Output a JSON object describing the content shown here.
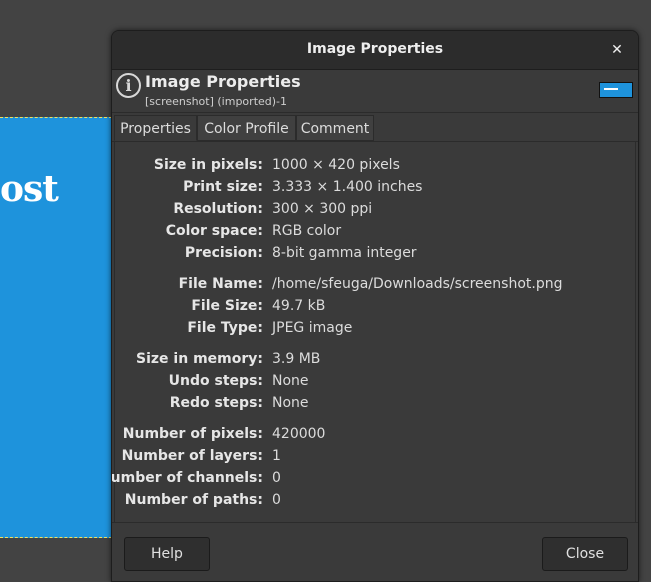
{
  "canvas": {
    "text": "ost"
  },
  "dialog": {
    "title": "Image Properties",
    "close_glyph": "✕",
    "header": {
      "icon": "info-icon",
      "title": "Image Properties",
      "subtitle": "[screenshot] (imported)-1"
    },
    "tabs": [
      {
        "label": "Properties",
        "active": true
      },
      {
        "label": "Color Profile",
        "active": false
      },
      {
        "label": "Comment",
        "active": false
      }
    ],
    "properties": [
      {
        "label": "Size in pixels:",
        "value": "1000 × 420 pixels"
      },
      {
        "label": "Print size:",
        "value": "3.333 × 1.400 inches"
      },
      {
        "label": "Resolution:",
        "value": "300 × 300 ppi"
      },
      {
        "label": "Color space:",
        "value": "RGB color"
      },
      {
        "label": "Precision:",
        "value": "8-bit gamma integer"
      },
      {
        "label": "File Name:",
        "value": "/home/sfeuga/Downloads/screenshot.png"
      },
      {
        "label": "File Size:",
        "value": "49.7 kB"
      },
      {
        "label": "File Type:",
        "value": "JPEG image"
      },
      {
        "label": "Size in memory:",
        "value": "3.9 MB"
      },
      {
        "label": "Undo steps:",
        "value": "None"
      },
      {
        "label": "Redo steps:",
        "value": "None"
      },
      {
        "label": "Number of pixels:",
        "value": "420000"
      },
      {
        "label": "Number of layers:",
        "value": "1"
      },
      {
        "label": "Number of channels:",
        "value": "0"
      },
      {
        "label": "Number of paths:",
        "value": "0"
      }
    ],
    "buttons": {
      "help": "Help",
      "close": "Close"
    }
  }
}
